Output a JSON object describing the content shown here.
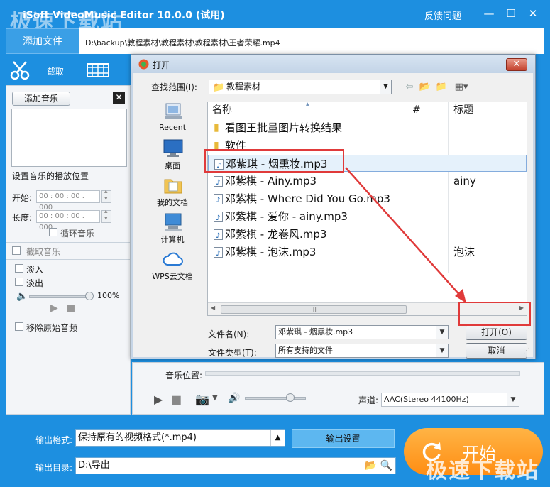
{
  "titlebar": {
    "app_title": "iSoft VideoMusic Editor 10.0.0 (试用)",
    "watermark": "极速下载站",
    "feedback": "反馈问题",
    "min_glyph": "—",
    "max_glyph": "☐",
    "close_glyph": "✕"
  },
  "tabs": {
    "add_file": "添加文件",
    "current_path": "D:\\backup\\教程素材\\教程素材\\教程素材\\王者荣耀.mp4",
    "crop": "截取"
  },
  "left_panel": {
    "add_music": "添加音乐",
    "close_glyph": "✕",
    "set_position": "设置音乐的播放位置",
    "start_label": "开始:",
    "start_value": "00 : 00 : 00 . 000",
    "length_label": "长度:",
    "length_value": "00 : 00 : 00 . 000",
    "loop_music": "循环音乐",
    "crop_music": "截取音乐",
    "fade_in": "淡入",
    "fade_out": "淡出",
    "volume_percent": "100%",
    "remove_original": "移除原始音频"
  },
  "main_area": {
    "music_position": "音乐位置:",
    "channel_label": "声道:",
    "channel_value": "AAC(Stereo 44100Hz)"
  },
  "bottom_bar": {
    "output_format_label": "输出格式:",
    "output_format_value": "保持原有的视频格式(*.mp4)",
    "output_settings": "输出设置",
    "output_dir_label": "输出目录:",
    "output_dir_value": "D:\\导出",
    "start_button": "开始",
    "watermark": "极速下载站"
  },
  "dialog": {
    "title": "打开",
    "close_glyph": "✕",
    "look_in_label": "查找范围(I):",
    "look_in_value": "教程素材",
    "places": [
      {
        "label": "Recent"
      },
      {
        "label": "桌面"
      },
      {
        "label": "我的文档"
      },
      {
        "label": "计算机"
      },
      {
        "label": "WPS云文档"
      }
    ],
    "columns": {
      "name": "名称",
      "number": "#",
      "title": "标题"
    },
    "files": [
      {
        "name": "看图王批量图片转换结果",
        "title": "",
        "type": "folder"
      },
      {
        "name": "软件",
        "title": "",
        "type": "folder"
      },
      {
        "name": "邓紫琪 - 烟熏妆.mp3",
        "title": "",
        "type": "audio"
      },
      {
        "name": "邓紫棋 - Ainy.mp3",
        "title": "ainy",
        "type": "audio"
      },
      {
        "name": "邓紫棋 - Where Did You Go.mp3",
        "title": "",
        "type": "audio"
      },
      {
        "name": "邓紫棋 - 爱你 - ainy.mp3",
        "title": "",
        "type": "audio"
      },
      {
        "name": "邓紫棋 - 龙卷风.mp3",
        "title": "",
        "type": "audio"
      },
      {
        "name": "邓紫棋 - 泡沫.mp3",
        "title": "泡沫",
        "type": "audio"
      }
    ],
    "filename_label": "文件名(N):",
    "filename_value": "邓紫琪 - 烟熏妆.mp3",
    "filetype_label": "文件类型(T):",
    "filetype_value": "所有支持的文件",
    "open_button": "打开(O)",
    "cancel_button": "取消"
  },
  "colors": {
    "brand_blue": "#1d8fe0",
    "start_orange": "#ff9a1f",
    "annotation_red": "#e03a3a",
    "selection_bg": "#e5f1fb"
  }
}
